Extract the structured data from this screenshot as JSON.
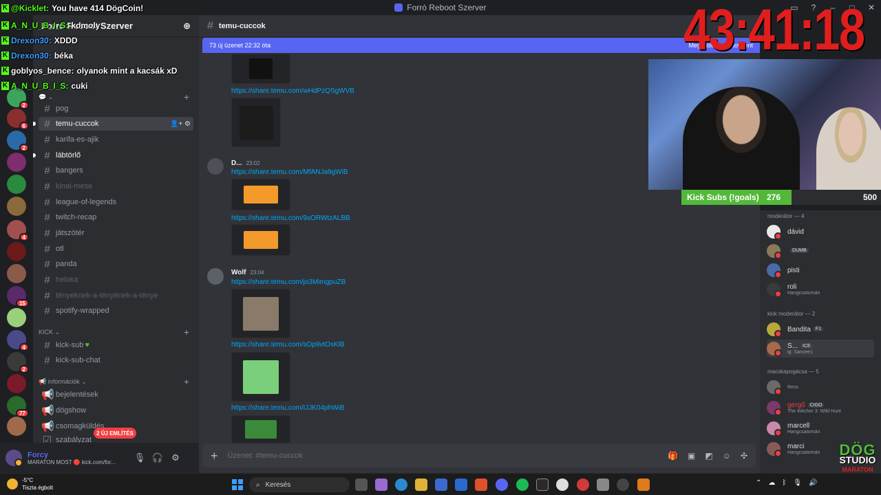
{
  "window": {
    "title": "Forró Reboot Szerver"
  },
  "server": {
    "name": "Forró Reboot Szerver"
  },
  "channel_list": [
    {
      "label": "pog",
      "style": "normal"
    },
    {
      "label": "temu-cuccok",
      "style": "active"
    },
    {
      "label": "karifa-es-ajik",
      "style": "normal"
    },
    {
      "label": "lábtörlő",
      "style": "bright"
    },
    {
      "label": "bangers",
      "style": "normal"
    },
    {
      "label": "kinai-mese",
      "style": "muted"
    },
    {
      "label": "league-of-legends",
      "style": "normal"
    },
    {
      "label": "twitch-recap",
      "style": "normal"
    },
    {
      "label": "játszótér",
      "style": "normal"
    },
    {
      "label": "otl",
      "style": "normal"
    },
    {
      "label": "panda",
      "style": "normal"
    },
    {
      "label": "heloka",
      "style": "muted"
    },
    {
      "label": "tényeknek-a-tényének-a-ténye",
      "style": "muted"
    },
    {
      "label": "spotify-wrapped",
      "style": "normal"
    }
  ],
  "categories": {
    "kick": "KICK",
    "info": "információk"
  },
  "kick_channels": [
    "kick-sub",
    "kick-sub-chat"
  ],
  "info_channels": [
    "bejelentések",
    "dögshow",
    "csomagküldés",
    "szabályzat"
  ],
  "server_badges": [
    "36",
    "2",
    "6",
    "2",
    "4",
    "2",
    "15",
    "4",
    "2",
    "77"
  ],
  "pills": {
    "new": "ÚJ",
    "mentions": "2 ÚJ EMLÍTÉS"
  },
  "user": {
    "name": "Forcy",
    "status": "MARATON MOST 🔴 kick.com/for..."
  },
  "chat": {
    "channel": "temu-cuccok",
    "new_messages": "73 új üzenet 22:32 óta",
    "mark_read": "Megjelölés olvasottként",
    "links": [
      "https://share.temu.com/wHdPzQSgWVB",
      "https://share.temu.com/MfANJa9gWiB",
      "https://share.temu.com/9xORWtzALBB",
      "https://share.temu.com/jo3MimgpuZB",
      "https://share.temu.com/sOp9vtOsKlB",
      "https://share.temu.com/IJJK04phWiB"
    ],
    "author1": {
      "name": "D...",
      "time": "23:02"
    },
    "author2": {
      "name": "Wolf",
      "time": "23:04"
    },
    "placeholder": "Üzenet: #temu-cuccok"
  },
  "members": {
    "cat1": "moderátor — 4",
    "cat2": "kick moderátor — 2",
    "cat3": "macskapogácsa — 5",
    "list": [
      {
        "name": "dávid",
        "sub": "",
        "tag": "",
        "red": false
      },
      {
        "name": "",
        "sub": "",
        "tag": "DUMB",
        "red": false
      },
      {
        "name": "pisti",
        "sub": "",
        "tag": "",
        "red": false
      },
      {
        "name": "roli",
        "sub": "Hangcsatornán",
        "tag": "",
        "red": false
      },
      {
        "name": "Bandita",
        "sub": "",
        "tag": "F1",
        "red": false
      },
      {
        "name": "S...",
        "sub": "ig: Sancee1",
        "tag": "ICE",
        "red": false
      },
      {
        "name": "",
        "sub": "Ress",
        "tag": "",
        "red": false
      },
      {
        "name": "gergő",
        "sub": "The Witcher 3: Wild Hunt",
        "tag": "CIGO",
        "red": true
      },
      {
        "name": "marcell",
        "sub": "Hangcsatornán",
        "tag": "",
        "red": false
      },
      {
        "name": "marci",
        "sub": "Hangcsatornán",
        "tag": "",
        "red": false
      }
    ]
  },
  "stream": {
    "timer": "43:41:18",
    "subs_label": "Kick Subs (!goals)",
    "subs_current": "276",
    "subs_goal": "500",
    "subs_progress": 0.552,
    "brand_line1": "DÖG",
    "brand_line2": "STUDIO",
    "brand_line3": "MARATON"
  },
  "overlay_chat": [
    {
      "user": "@Kicklet:",
      "text": "You have 414 DögCoin!",
      "color": "#53fc18"
    },
    {
      "user": "A_N_U_B_I_S:",
      "text": "komoly",
      "color": "#53fc18"
    },
    {
      "user": "Drexon30:",
      "text": "XDDD",
      "color": "#3aa0ff"
    },
    {
      "user": "Drexon30:",
      "text": "béka",
      "color": "#3aa0ff"
    },
    {
      "user": "goblyos_bence:",
      "text": "olyanok mint a kacsák xD",
      "color": "#ffffff"
    },
    {
      "user": "A_N_U_B_I_S:",
      "text": "cuki",
      "color": "#53fc18"
    }
  ],
  "taskbar": {
    "temp": "-5°C",
    "weather": "Tiszta égbolt",
    "search": "Keresés"
  },
  "colors": {
    "accent": "#5865f2",
    "link": "#00a8fc",
    "kick_green": "#53fc18",
    "timer_red": "#e01e1e"
  }
}
